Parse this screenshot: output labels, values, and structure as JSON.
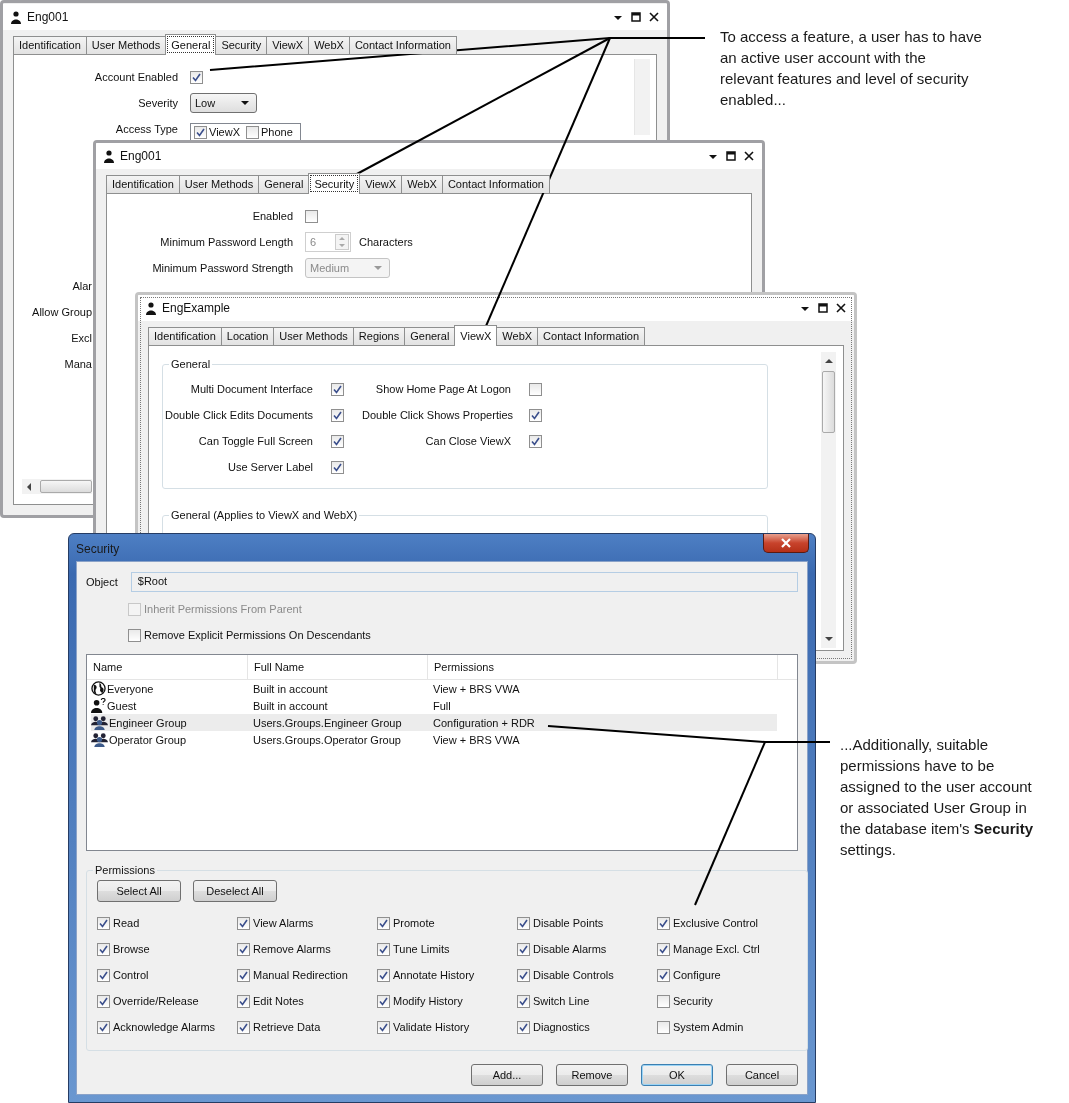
{
  "general_window": {
    "title": "Eng001",
    "tabs": [
      {
        "label": "Identification",
        "selected": false
      },
      {
        "label": "User Methods",
        "selected": false
      },
      {
        "label": "General",
        "selected": true
      },
      {
        "label": "Security",
        "selected": false
      },
      {
        "label": "ViewX",
        "selected": false
      },
      {
        "label": "WebX",
        "selected": false
      },
      {
        "label": "Contact Information",
        "selected": false
      }
    ],
    "fields": [
      {
        "label": "Account Enabled",
        "kind": "checkbox",
        "checked": true
      },
      {
        "label": "Severity",
        "kind": "dropdown",
        "value": "Low",
        "disabled": false
      },
      {
        "label": "Access Type",
        "kind": "options",
        "options": [
          {
            "label": "ViewX",
            "checked": true
          },
          {
            "label": "Phone",
            "checked": false
          }
        ]
      }
    ],
    "cut_labels": [
      "Alar",
      "Allow Group",
      "Excl",
      "Mana"
    ]
  },
  "security_window": {
    "title": "Eng001",
    "tabs": [
      {
        "label": "Identification",
        "selected": false
      },
      {
        "label": "User Methods",
        "selected": false
      },
      {
        "label": "General",
        "selected": false
      },
      {
        "label": "Security",
        "selected": true
      },
      {
        "label": "ViewX",
        "selected": false
      },
      {
        "label": "WebX",
        "selected": false
      },
      {
        "label": "Contact Information",
        "selected": false
      }
    ],
    "fields": [
      {
        "label": "Enabled",
        "kind": "checkbox",
        "checked": false
      },
      {
        "label": "Minimum Password Length",
        "kind": "spinner",
        "value": "6",
        "unit": "Characters",
        "disabled": true
      },
      {
        "label": "Minimum Password Strength",
        "kind": "dropdown",
        "value": "Medium",
        "disabled": true
      }
    ]
  },
  "viewx_window": {
    "title": "EngExample",
    "tabs": [
      {
        "label": "Identification",
        "selected": false
      },
      {
        "label": "Location",
        "selected": false
      },
      {
        "label": "User Methods",
        "selected": false
      },
      {
        "label": "Regions",
        "selected": false
      },
      {
        "label": "General",
        "selected": false
      },
      {
        "label": "ViewX",
        "selected": true
      },
      {
        "label": "WebX",
        "selected": false
      },
      {
        "label": "Contact Information",
        "selected": false
      }
    ],
    "groups": [
      {
        "title": "General",
        "options": [
          {
            "label": "Multi Document Interface",
            "checked": true
          },
          {
            "label": "Show Home Page At Logon",
            "checked": false
          },
          {
            "label": "Double Click Edits Documents",
            "checked": true
          },
          {
            "label": "Double Click Shows Properties",
            "checked": true
          },
          {
            "label": "Can Toggle Full Screen",
            "checked": true
          },
          {
            "label": "Can Close ViewX",
            "checked": true
          },
          {
            "label": "Use Server Label",
            "checked": true
          }
        ]
      },
      {
        "title": "General (Applies to ViewX and WebX)"
      }
    ]
  },
  "security_dialog": {
    "title": "Security",
    "object": {
      "label": "Object",
      "value": "$Root"
    },
    "inherit": {
      "label": "Inherit Permissions From Parent",
      "checked": false,
      "disabled": true
    },
    "remove_explicit": {
      "label": "Remove Explicit Permissions On Descendants",
      "checked": false,
      "disabled": false
    },
    "list": {
      "columns": [
        "Name",
        "Full Name",
        "Permissions"
      ],
      "rows": [
        {
          "kind": "world",
          "name": "Everyone",
          "full_name": "Built in account",
          "permissions": "View + BRS VWA",
          "selected": false
        },
        {
          "kind": "guest",
          "name": "Guest",
          "full_name": "Built in account",
          "permissions": "Full",
          "selected": false
        },
        {
          "kind": "group",
          "name": "Engineer Group",
          "full_name": "Users.Groups.Engineer Group",
          "permissions": "Configuration + RDR",
          "selected": true
        },
        {
          "kind": "group",
          "name": "Operator Group",
          "full_name": "Users.Groups.Operator Group",
          "permissions": "View + BRS VWA",
          "selected": false
        }
      ]
    },
    "permissions": {
      "title": "Permissions",
      "buttons": [
        "Select All",
        "Deselect All"
      ],
      "items": [
        {
          "label": "Read",
          "checked": true
        },
        {
          "label": "View Alarms",
          "checked": true
        },
        {
          "label": "Promote",
          "checked": true
        },
        {
          "label": "Disable Points",
          "checked": true
        },
        {
          "label": "Exclusive Control",
          "checked": true
        },
        {
          "label": "Browse",
          "checked": true
        },
        {
          "label": "Remove Alarms",
          "checked": true
        },
        {
          "label": "Tune Limits",
          "checked": true
        },
        {
          "label": "Disable Alarms",
          "checked": true
        },
        {
          "label": "Manage Excl. Ctrl",
          "checked": true
        },
        {
          "label": "Control",
          "checked": true
        },
        {
          "label": "Manual Redirection",
          "checked": true
        },
        {
          "label": "Annotate History",
          "checked": true
        },
        {
          "label": "Disable Controls",
          "checked": true
        },
        {
          "label": "Configure",
          "checked": true
        },
        {
          "label": "Override/Release",
          "checked": true
        },
        {
          "label": "Edit Notes",
          "checked": true
        },
        {
          "label": "Modify History",
          "checked": true
        },
        {
          "label": "Switch Line",
          "checked": true
        },
        {
          "label": "Security",
          "checked": false
        },
        {
          "label": "Acknowledge Alarms",
          "checked": true
        },
        {
          "label": "Retrieve Data",
          "checked": true
        },
        {
          "label": "Validate History",
          "checked": true
        },
        {
          "label": "Diagnostics",
          "checked": true
        },
        {
          "label": "System Admin",
          "checked": false
        }
      ]
    },
    "buttons": [
      {
        "label": "Add...",
        "default": false
      },
      {
        "label": "Remove",
        "default": false
      },
      {
        "label": "OK",
        "default": true
      },
      {
        "label": "Cancel",
        "default": false
      }
    ]
  },
  "annotations": [
    {
      "text": "To access a feature, a user has to have an active user account with the relevant features and level of security enabled..."
    },
    {
      "text": "...Additionally, suitable permissions have to be assigned to the user account or associated User Group in the database item's **Security** settings."
    }
  ]
}
